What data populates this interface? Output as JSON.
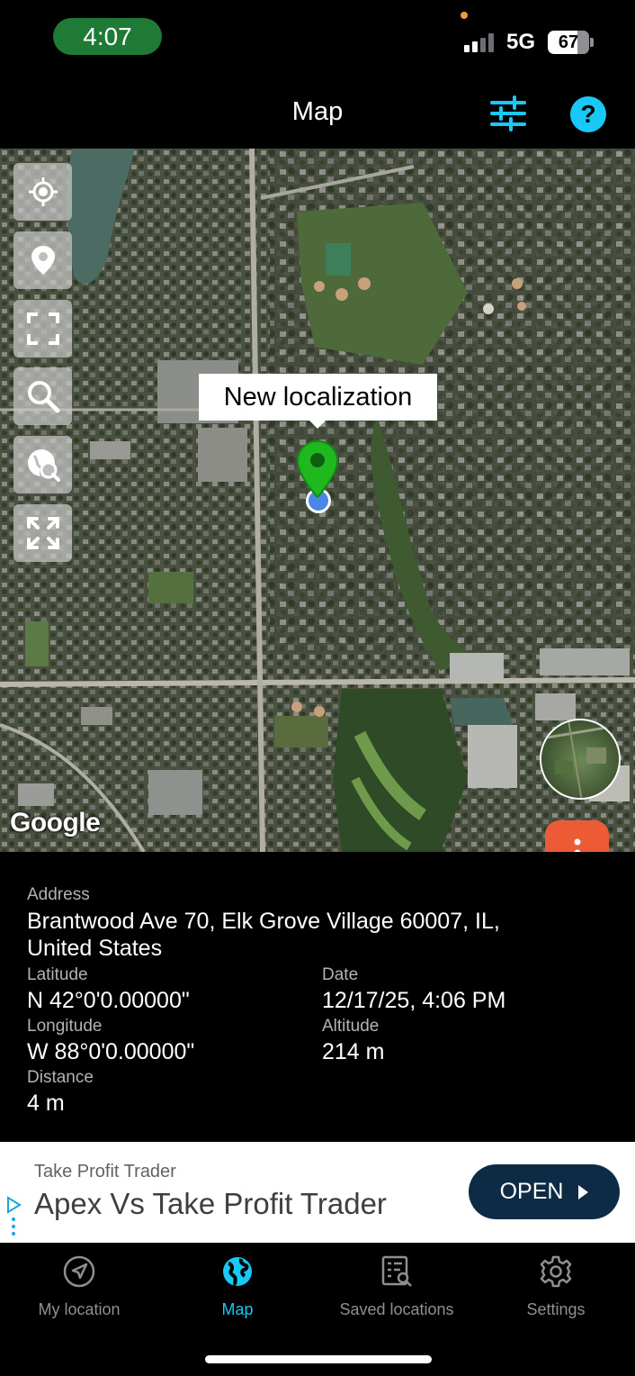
{
  "status_bar": {
    "time": "4:07",
    "network": "5G",
    "battery_percent": "67"
  },
  "header": {
    "title": "Map",
    "help_label": "?"
  },
  "map": {
    "callout_text": "New localization",
    "attribution": "Google",
    "controls": [
      "locate-me-icon",
      "pin-icon",
      "fit-bounds-icon",
      "search-icon",
      "globe-search-icon",
      "expand-icon"
    ],
    "colors": {
      "pin": "#1fb81f",
      "user_dot": "#4a86e8",
      "fab": "#ec5a36"
    }
  },
  "details": {
    "address_label": "Address",
    "address_line1": "Brantwood Ave 70, Elk Grove Village 60007, IL,",
    "address_line2": "United States",
    "latitude_label": "Latitude",
    "latitude_value": "N 42°0'0.00000\"",
    "date_label": "Date",
    "date_value": "12/17/25, 4:06 PM",
    "longitude_label": "Longitude",
    "longitude_value": "W 88°0'0.00000\"",
    "altitude_label": "Altitude",
    "altitude_value": "214 m",
    "distance_label": "Distance",
    "distance_value": "4 m"
  },
  "ad": {
    "advertiser": "Take Profit Trader",
    "headline": "Apex Vs Take Profit Trader",
    "cta": "OPEN"
  },
  "nav": {
    "items": [
      {
        "label": "My location",
        "icon": "navigation-arrow-icon"
      },
      {
        "label": "Map",
        "icon": "globe-icon"
      },
      {
        "label": "Saved locations",
        "icon": "saved-list-icon"
      },
      {
        "label": "Settings",
        "icon": "gear-icon"
      }
    ],
    "active": "Map",
    "accent": "#18c8f5"
  }
}
